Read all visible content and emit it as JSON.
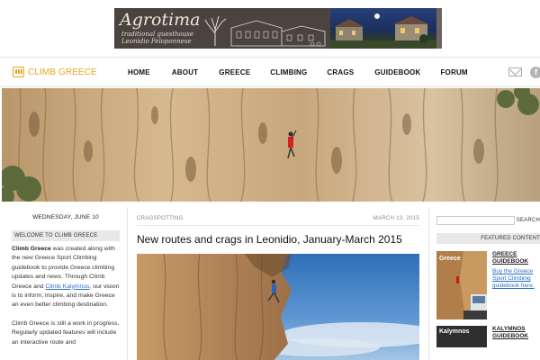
{
  "banner": {
    "logo_text": "Agrotima",
    "tagline_1": "traditional guesthouse",
    "tagline_2": "Leonidio Peloponnese"
  },
  "header": {
    "site_name": "CLIMB GREECE",
    "menu": [
      "HOME",
      "ABOUT",
      "GREECE",
      "CLIMBING",
      "CRAGS",
      "GUIDEBOOK",
      "FORUM"
    ],
    "facebook_glyph": "f"
  },
  "sidebar_left": {
    "date": "WEDNESDAY, JUNE 10",
    "box_title": "WELCOME TO CLIMB GREECE",
    "p1_bold": "Climb Greece",
    "p1_text": " was created along with the new Greece Sport Climbing guidebook to provide Greece climbing updates and news. Through Climb Greece and ",
    "p1_link": "Climb Kalymnos",
    "p1_end": ", our vision is to inform, inspire, and make Greece an even better climbing destination.",
    "p2": "Climb Greece is still a work in progress. Regularly updated features will include an interactive route and"
  },
  "post": {
    "category": "CRAGSPOTTING",
    "date": "MARCH 13, 2015",
    "title": "New routes and crags in Leonidio, January-March 2015"
  },
  "sidebar_right": {
    "search_placeholder": "",
    "search_label": "SEARCH",
    "featured_title": "FEATURED CONTENT",
    "items": [
      {
        "thumb_label": "Greece",
        "title": "GREECE GUIDEBOOK",
        "desc": "Buy the Greece Sport Climbing guidebook here."
      },
      {
        "thumb_label": "Kalymnos",
        "title": "KALYMNOS GUIDEBOOK",
        "desc": ""
      }
    ]
  },
  "colors": {
    "accent": "#e7a51d",
    "link": "#2a6fc9",
    "box_bg": "#e8e8e8"
  },
  "icons": [
    "tree-icon",
    "logo-icon",
    "mail-icon",
    "facebook-icon"
  ]
}
